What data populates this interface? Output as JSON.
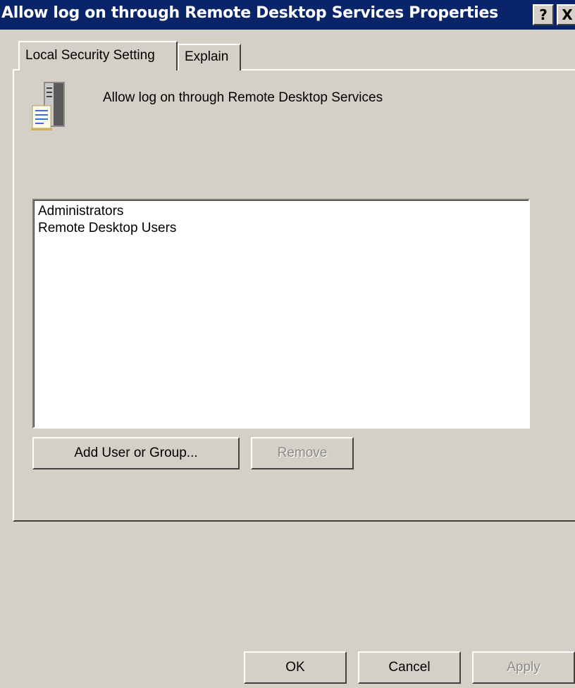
{
  "window": {
    "title": "Allow log on through Remote Desktop Services Properties",
    "help_button": "?",
    "close_button": "X"
  },
  "tabs": [
    {
      "label": "Local Security Setting",
      "active": true
    },
    {
      "label": "Explain",
      "active": false
    }
  ],
  "policy": {
    "icon": "server-policy-icon",
    "name": "Allow log on through Remote Desktop Services"
  },
  "members": [
    "Administrators",
    "Remote Desktop Users"
  ],
  "actions": {
    "add_label": "Add User or Group...",
    "remove_label": "Remove"
  },
  "footer": {
    "ok_label": "OK",
    "cancel_label": "Cancel",
    "apply_label": "Apply"
  }
}
